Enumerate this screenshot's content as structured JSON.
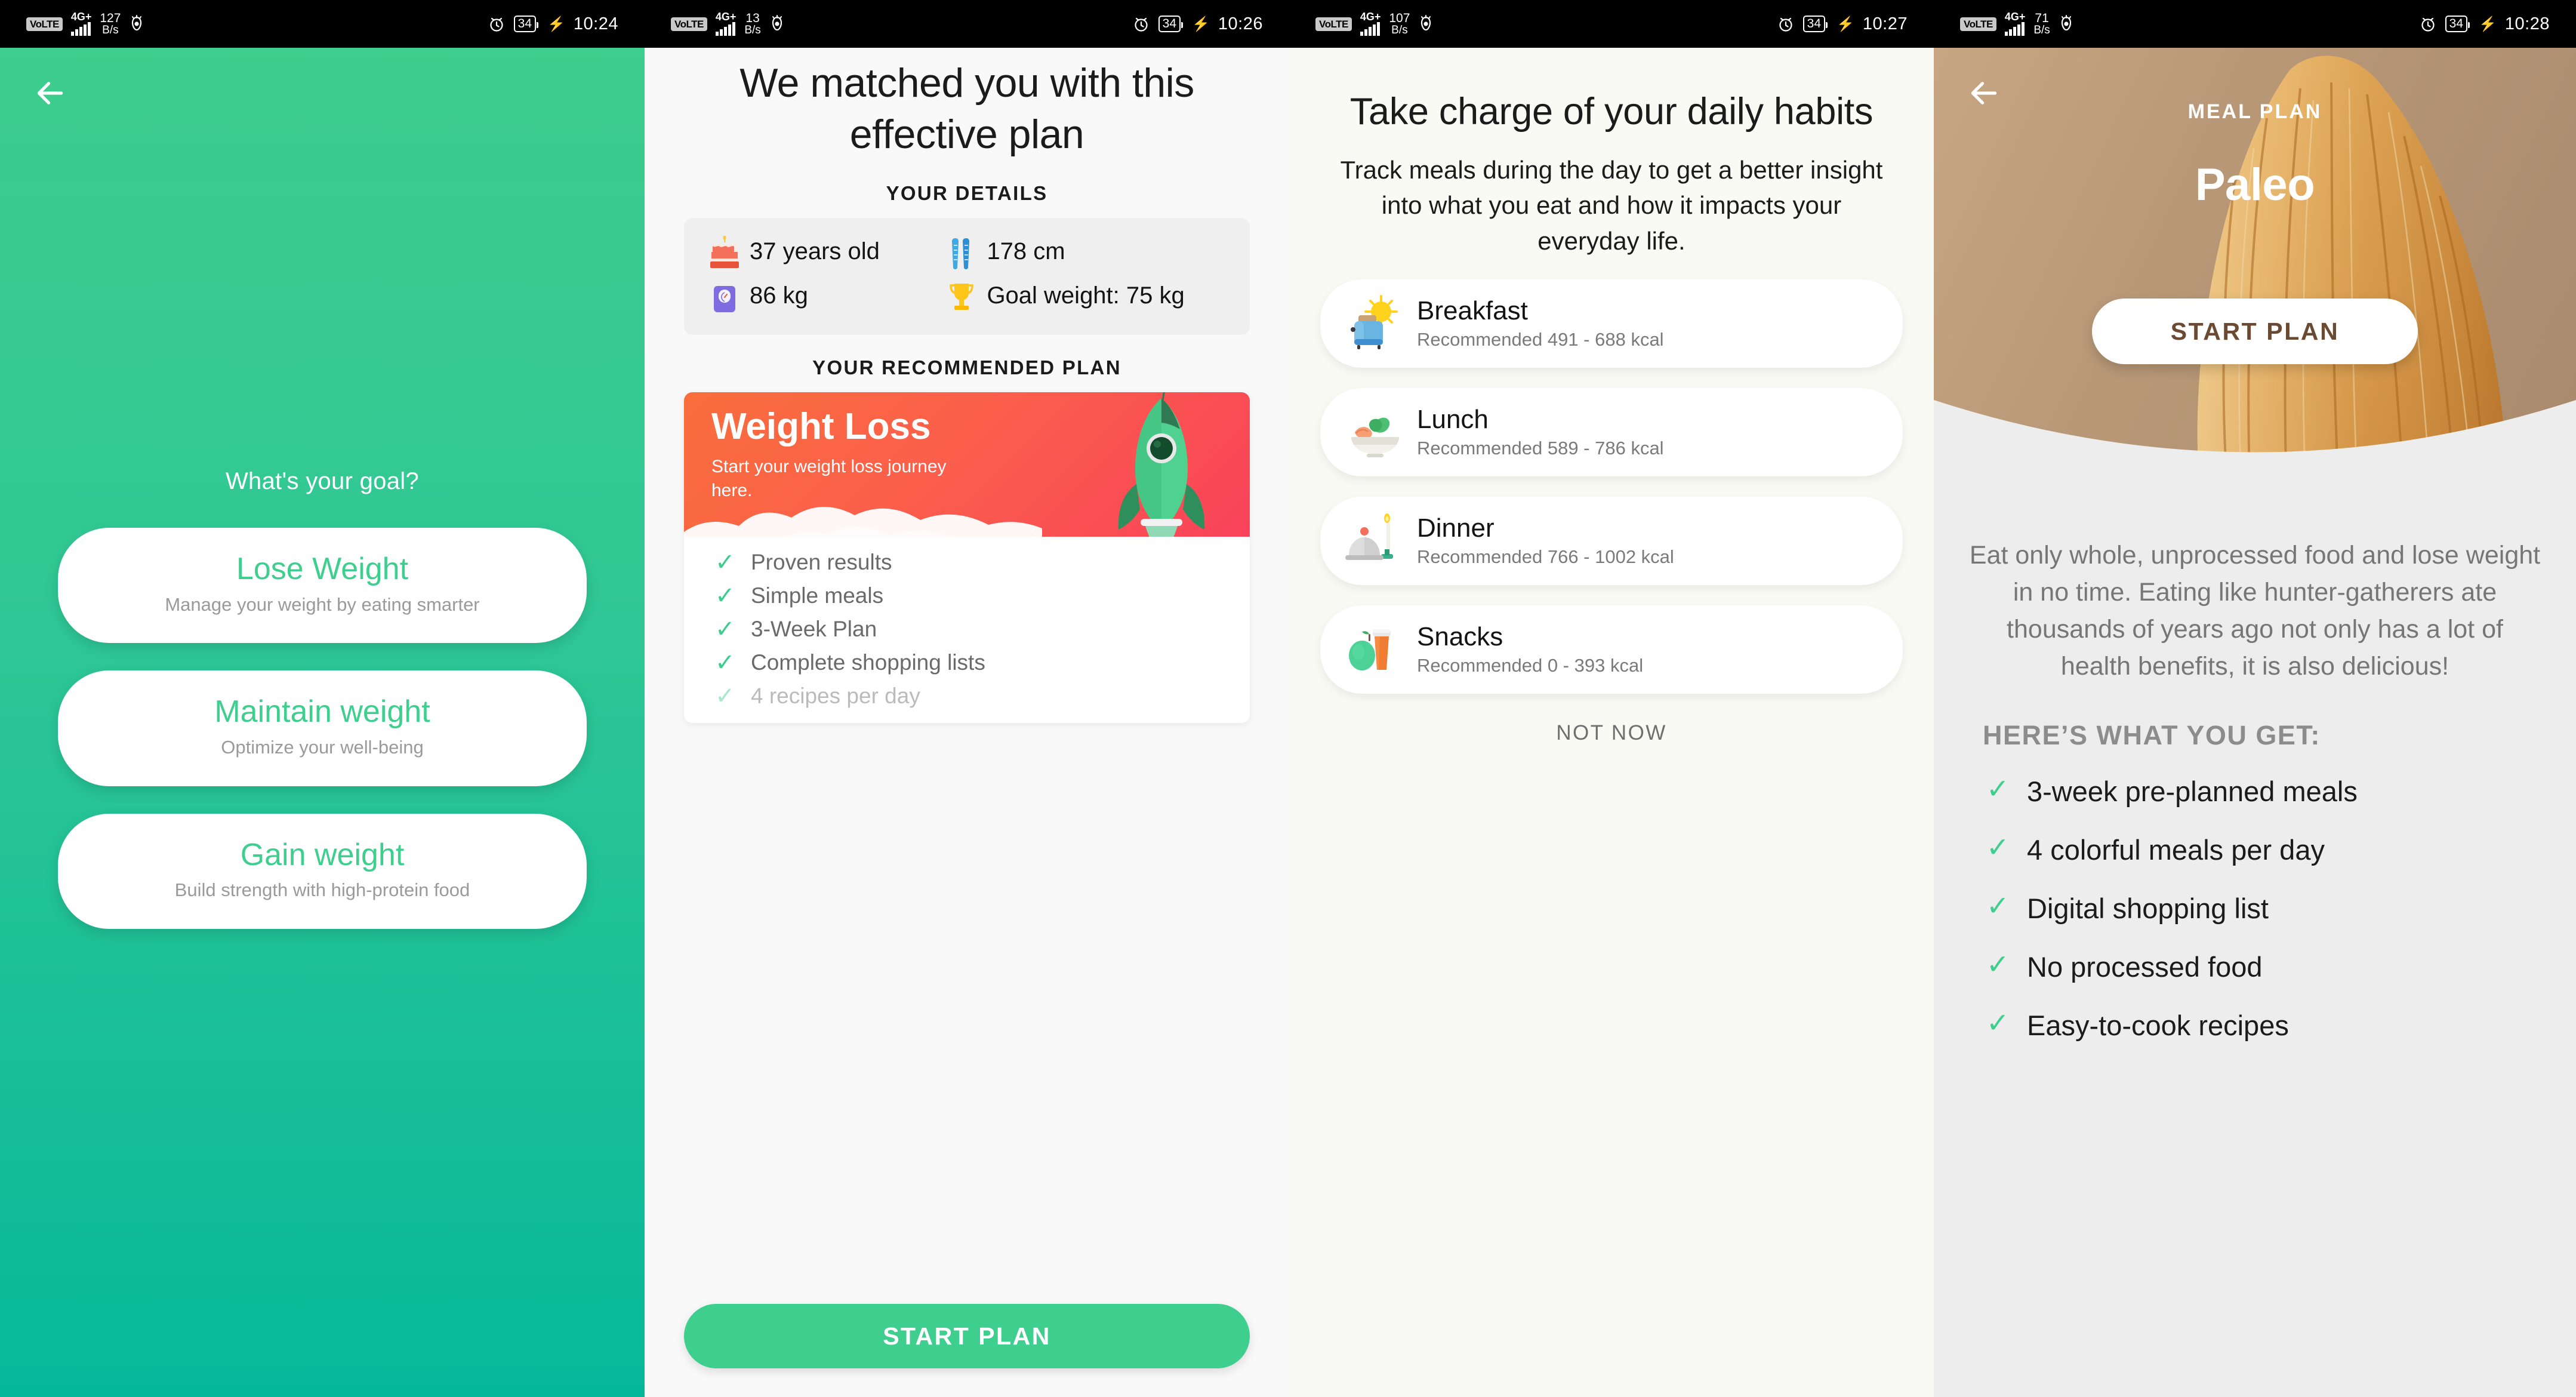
{
  "panels": [
    {
      "status": {
        "carrier": "VoLTE",
        "network": "4G+",
        "speed": "127",
        "speed_unit": "B/s",
        "battery": "34",
        "time": "10:24"
      },
      "goal_question": "What's your goal?",
      "goals": [
        {
          "title": "Lose Weight",
          "subtitle": "Manage your weight by eating smarter"
        },
        {
          "title": "Maintain weight",
          "subtitle": "Optimize your well-being"
        },
        {
          "title": "Gain weight",
          "subtitle": "Build strength with high-protein food"
        }
      ]
    },
    {
      "status": {
        "carrier": "VoLTE",
        "network": "4G+",
        "speed": "13",
        "speed_unit": "B/s",
        "battery": "34",
        "time": "10:26"
      },
      "heading": "We matched you with this effective plan",
      "details_label": "YOUR DETAILS",
      "details": {
        "age": "37 years old",
        "height": "178 cm",
        "weight": "86 kg",
        "goal_weight": "Goal weight: 75 kg"
      },
      "plan_label": "YOUR RECOMMENDED PLAN",
      "plan": {
        "name": "Weight Loss",
        "description": "Start your weight loss journey here."
      },
      "features": [
        "Proven results",
        "Simple meals",
        "3-Week Plan",
        "Complete shopping lists",
        "4 recipes per day"
      ],
      "start_button": "START PLAN"
    },
    {
      "status": {
        "carrier": "VoLTE",
        "network": "4G+",
        "speed": "107",
        "speed_unit": "B/s",
        "battery": "34",
        "time": "10:27"
      },
      "heading": "Take charge of your daily habits",
      "subheading": "Track meals during the day to get a better insight into what you eat and how it impacts your everyday life.",
      "meals": [
        {
          "name": "Breakfast",
          "kcal": "Recommended 491 - 688 kcal",
          "icon": "toaster-sun-icon"
        },
        {
          "name": "Lunch",
          "kcal": "Recommended 589 - 786 kcal",
          "icon": "salad-bowl-icon"
        },
        {
          "name": "Dinner",
          "kcal": "Recommended 766 - 1002 kcal",
          "icon": "cloche-candle-icon"
        },
        {
          "name": "Snacks",
          "kcal": "Recommended 0 - 393 kcal",
          "icon": "apple-smoothie-icon"
        }
      ],
      "not_now": "NOT NOW"
    },
    {
      "status": {
        "carrier": "VoLTE",
        "network": "4G+",
        "speed": "71",
        "speed_unit": "B/s",
        "battery": "34",
        "time": "10:28"
      },
      "tag": "MEAL PLAN",
      "title": "Paleo",
      "start_button": "START PLAN",
      "description": "Eat only whole, unprocessed food and lose weight in no time. Eating like hunter-gatherers ate thousands of years ago not only has a lot of health benefits, it is also delicious!",
      "get_label": "HERE’S WHAT YOU GET:",
      "benefits": [
        "3-week pre-planned meals",
        "4 colorful meals per day",
        "Digital shopping list",
        "No processed food",
        "Easy-to-cook recipes"
      ]
    }
  ],
  "colors": {
    "green": "#3ECE8D",
    "green_dark": "#06B89A",
    "plan_red": "#FB5F4B",
    "paleo_brown": "#B89877",
    "check": "#3ECE8D"
  },
  "icons": {
    "back": "arrow-left-icon",
    "check": "✓",
    "birthday_cake": "birthday-cake-icon",
    "ski": "ski-icon",
    "scale": "bathroom-scale-icon",
    "trophy": "trophy-icon",
    "rocket": "rocket-icon"
  }
}
